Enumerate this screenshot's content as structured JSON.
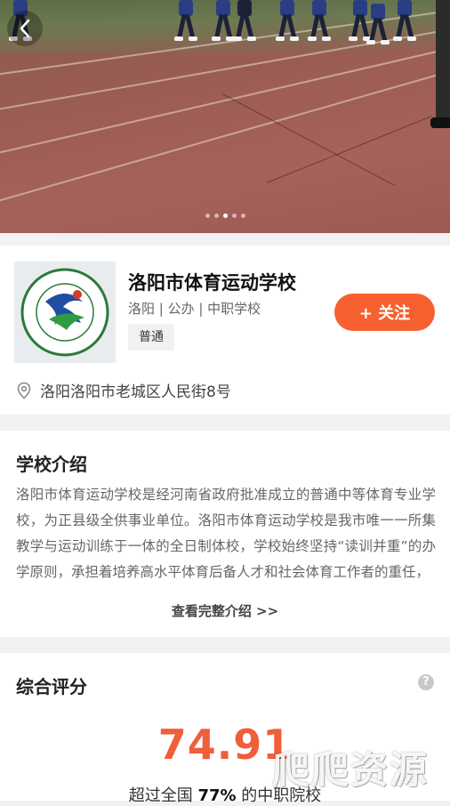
{
  "hero": {
    "slide_count": 5,
    "active_slide": 3
  },
  "school": {
    "name": "洛阳市体育运动学校",
    "meta": "洛阳 | 公办 | 中职学校",
    "tag": "普通",
    "follow_label": "+ 关注",
    "address": "洛阳洛阳市老城区人民街8号",
    "logo_text_top": "洛阳市体育运动学校",
    "logo_text_bottom": "LUOYANG SPORTS SCHOOL OF CHINA"
  },
  "intro": {
    "title": "学校介绍",
    "text": "洛阳市体育运动学校是经河南省政府批准成立的普通中等体育专业学校，为正县级全供事业单位。洛阳市体育运动学校是我市唯一一所集教学与运动训练于一体的全日制体校，学校始终坚持“读训并重”的办学原则，承担着培养高水平体育后备人才和社会体育工作者的重任，",
    "more_label": "查看完整介绍 >>"
  },
  "score": {
    "title": "综合评分",
    "help_icon": "?",
    "value": "74.91",
    "compare_prefix": "超过全国 ",
    "compare_pct": "77%",
    "compare_suffix": " 的中职院校"
  },
  "watermark": "爬爬资源",
  "colors": {
    "accent": "#f7612f",
    "score": "#ee5f3a",
    "page_bg": "#f2f2f2"
  },
  "icons": {
    "back": "back-arrow-icon",
    "location": "location-pin-icon",
    "help": "help-icon"
  }
}
